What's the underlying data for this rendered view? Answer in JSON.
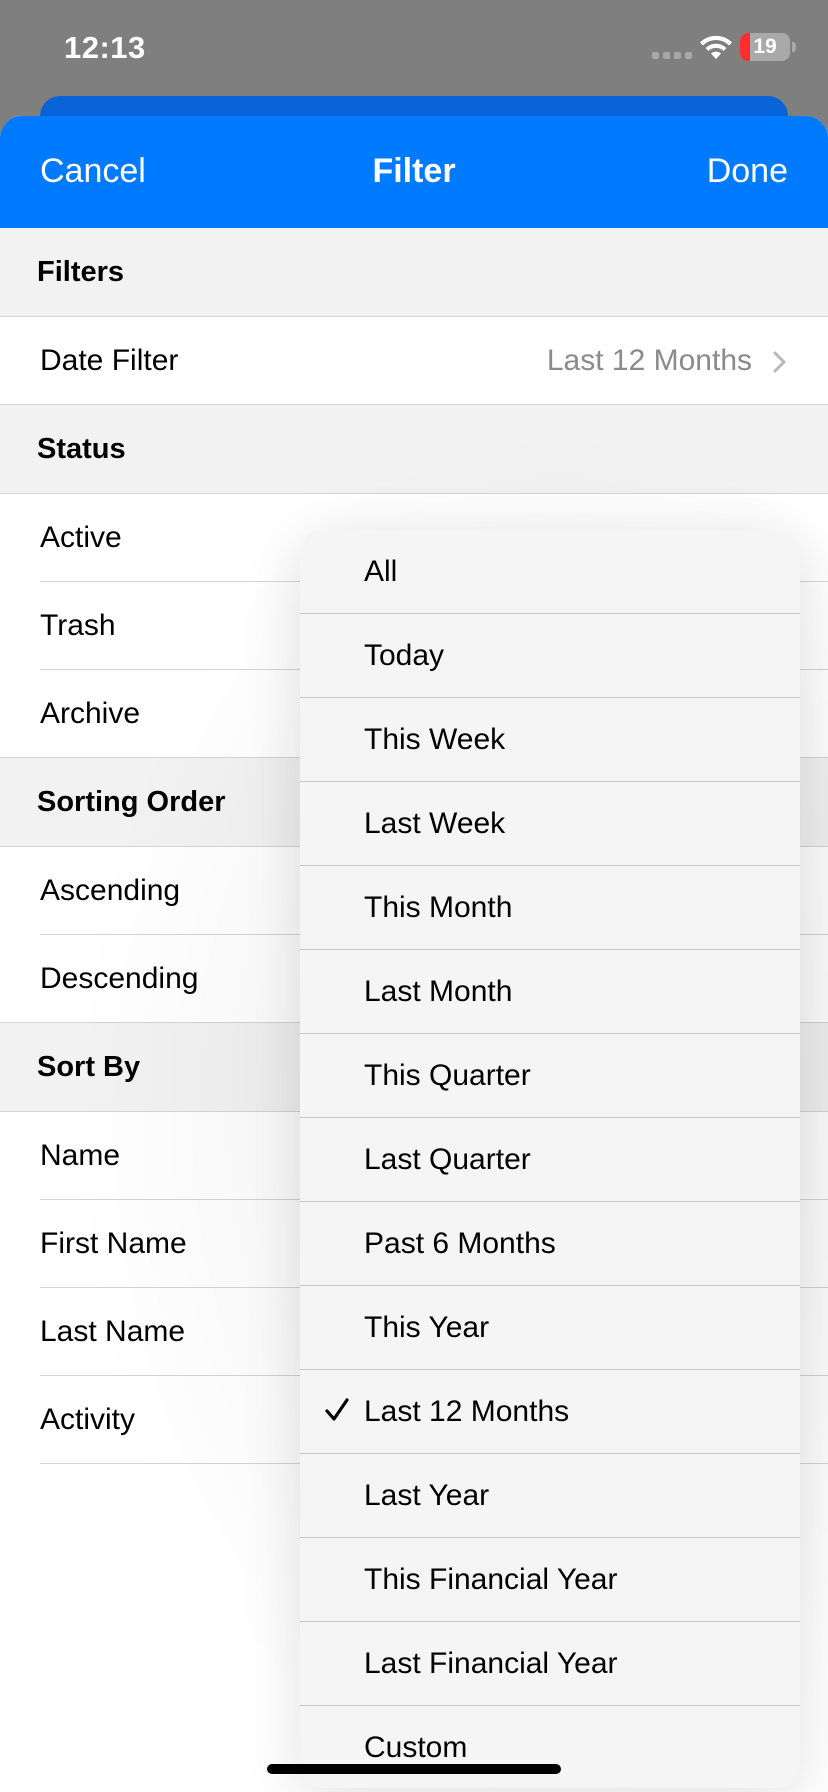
{
  "status_bar": {
    "time": "12:13",
    "battery": "19"
  },
  "nav": {
    "cancel": "Cancel",
    "title": "Filter",
    "done": "Done"
  },
  "sections": {
    "filters": {
      "header": "Filters",
      "date_filter_label": "Date Filter",
      "date_filter_value": "Last 12 Months"
    },
    "status": {
      "header": "Status",
      "items": [
        "Active",
        "Trash",
        "Archive"
      ]
    },
    "sorting_order": {
      "header": "Sorting Order",
      "items": [
        "Ascending",
        "Descending"
      ]
    },
    "sort_by": {
      "header": "Sort By",
      "items": [
        "Name",
        "First Name",
        "Last Name",
        "Activity"
      ]
    }
  },
  "date_menu": {
    "selected": "Last 12 Months",
    "options": [
      "All",
      "Today",
      "This Week",
      "Last Week",
      "This Month",
      "Last Month",
      "This Quarter",
      "Last Quarter",
      "Past 6 Months",
      "This Year",
      "Last 12 Months",
      "Last Year",
      "This Financial Year",
      "Last Financial Year",
      "Custom"
    ]
  },
  "colors": {
    "accent": "#007aff",
    "checkmark": "#000000"
  }
}
